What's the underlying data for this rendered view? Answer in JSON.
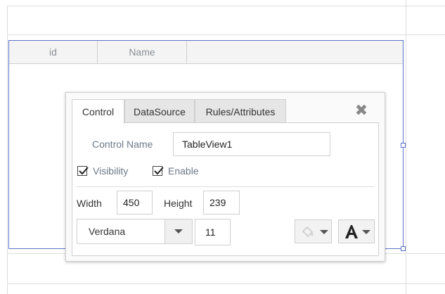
{
  "table": {
    "columns": [
      "id",
      "Name"
    ]
  },
  "dialog": {
    "tabs": [
      {
        "label": "Control",
        "active": true
      },
      {
        "label": "DataSource",
        "active": false
      },
      {
        "label": "Rules/Attributes",
        "active": false
      }
    ],
    "control_name_label": "Control Name",
    "control_name_value": "TableView1",
    "visibility_label": "Visibility",
    "visibility_checked": true,
    "enable_label": "Enable",
    "enable_checked": true,
    "width_label": "Width",
    "width_value": "450",
    "height_label": "Height",
    "height_value": "239",
    "font_family_value": "Verdana",
    "font_size_value": "11",
    "icons": {
      "close": "close-icon",
      "color_picker": "paint-bucket-icon",
      "font_style": "font-letter-icon"
    }
  },
  "colors": {
    "selection": "#5b72c8",
    "tab_inactive": "#e6e6e6"
  }
}
